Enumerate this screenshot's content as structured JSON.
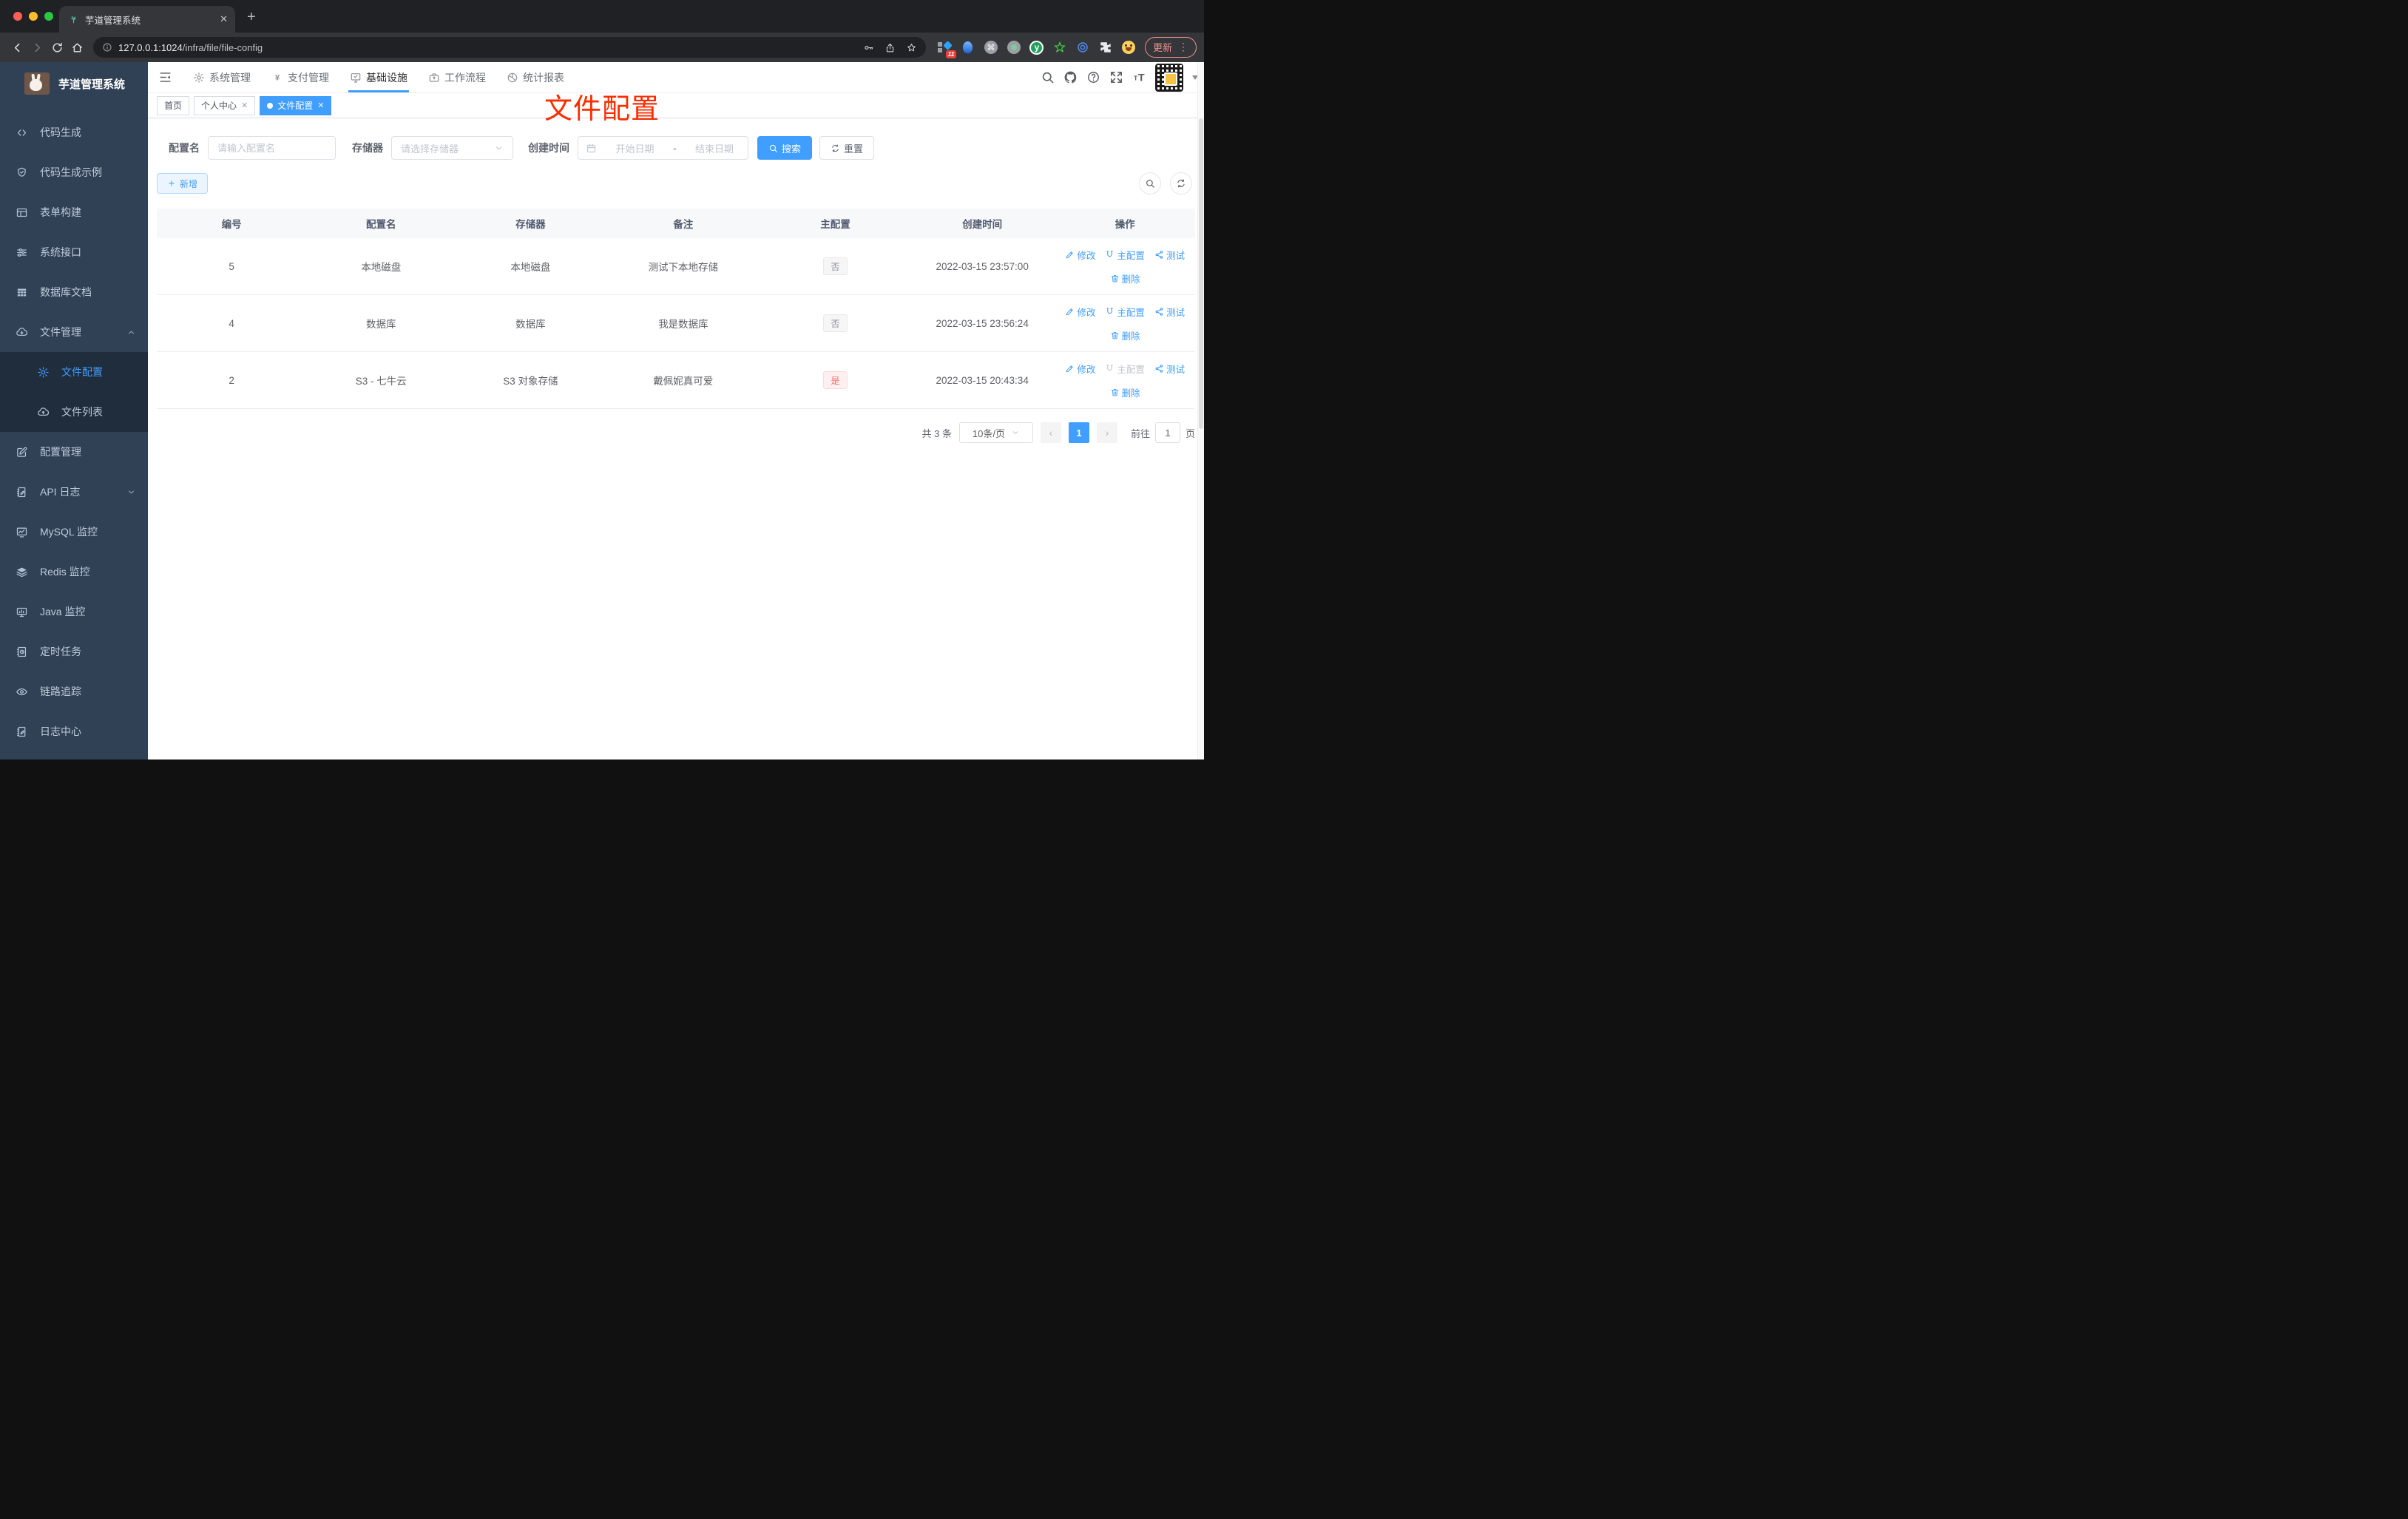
{
  "browser": {
    "tab_title": "芋道管理系统",
    "url_host": "127.0.0.1:1024",
    "url_path": "/infra/file/file-config",
    "update_label": "更新",
    "ext_badge": "11",
    "icons": [
      "back",
      "forward",
      "reload",
      "home",
      "info",
      "key",
      "share-up",
      "star",
      "puzzle",
      "menu-dots"
    ]
  },
  "colors": {
    "accent": "#409eff",
    "danger": "#f56c6c",
    "annotation_red": "#ff2d00",
    "sidebar_bg": "#304156",
    "submenu_bg": "#1f2d3d"
  },
  "sidebar": {
    "logo_title": "芋道管理系统",
    "items": [
      {
        "key": "code-generation",
        "label": "代码生成",
        "icon": "code"
      },
      {
        "key": "code-example",
        "label": "代码生成示例",
        "icon": "shield"
      },
      {
        "key": "form-builder",
        "label": "表单构建",
        "icon": "form"
      },
      {
        "key": "system-api",
        "label": "系统接口",
        "icon": "sliders"
      },
      {
        "key": "db-doc",
        "label": "数据库文档",
        "icon": "dbgrid"
      },
      {
        "key": "file-management",
        "label": "文件管理",
        "icon": "clouddown",
        "expanded": true,
        "children": [
          {
            "key": "file-config",
            "label": "文件配置",
            "icon": "gear",
            "active": true
          },
          {
            "key": "file-list",
            "label": "文件列表",
            "icon": "cloudup"
          }
        ]
      },
      {
        "key": "config-management",
        "label": "配置管理",
        "icon": "editsq"
      },
      {
        "key": "api-log",
        "label": "API 日志",
        "icon": "note",
        "collapsible": true
      },
      {
        "key": "mysql-monitor",
        "label": "MySQL 监控",
        "icon": "chart"
      },
      {
        "key": "redis-monitor",
        "label": "Redis 监控",
        "icon": "layers"
      },
      {
        "key": "java-monitor",
        "label": "Java 监控",
        "icon": "monitor"
      },
      {
        "key": "scheduled-task",
        "label": "定时任务",
        "icon": "schedule"
      },
      {
        "key": "trace",
        "label": "链路追踪",
        "icon": "eye"
      },
      {
        "key": "log-center",
        "label": "日志中心",
        "icon": "note"
      }
    ]
  },
  "topnav": {
    "active_index": 2,
    "items": [
      {
        "key": "system",
        "label": "系统管理",
        "icon": "gear"
      },
      {
        "key": "pay",
        "label": "支付管理",
        "icon": "yen"
      },
      {
        "key": "infra",
        "label": "基础设施",
        "icon": "infra"
      },
      {
        "key": "workflow",
        "label": "工作流程",
        "icon": "workflow"
      },
      {
        "key": "report",
        "label": "统计报表",
        "icon": "stats"
      }
    ],
    "right_icons": [
      "search",
      "github",
      "help",
      "fullscreen",
      "font-size",
      "avatar",
      "caret-down"
    ]
  },
  "tabs": [
    {
      "label": "首页",
      "closable": false,
      "active": false
    },
    {
      "label": "个人中心",
      "closable": true,
      "active": false
    },
    {
      "label": "文件配置",
      "closable": true,
      "active": true
    }
  ],
  "annotation": {
    "text": "文件配置"
  },
  "filters": {
    "config_name_label": "配置名",
    "config_name_placeholder": "请输入配置名",
    "storage_label": "存储器",
    "storage_placeholder": "请选择存储器",
    "created_label": "创建时间",
    "date_start_placeholder": "开始日期",
    "date_separator": "-",
    "date_end_placeholder": "结束日期",
    "search_label": "搜索",
    "reset_label": "重置"
  },
  "toolbar": {
    "add_label": "新增"
  },
  "table": {
    "columns": [
      "编号",
      "配置名",
      "存储器",
      "备注",
      "主配置",
      "创建时间",
      "操作"
    ],
    "action_labels": {
      "edit": "修改",
      "master": "主配置",
      "test": "测试",
      "delete": "删除"
    },
    "rows": [
      {
        "id": "5",
        "name": "本地磁盘",
        "storage": "本地磁盘",
        "remark": "测试下本地存储",
        "primary": "否",
        "primary_type": "info",
        "created": "2022-03-15 23:57:00",
        "master_disabled": false
      },
      {
        "id": "4",
        "name": "数据库",
        "storage": "数据库",
        "remark": "我是数据库",
        "primary": "否",
        "primary_type": "info",
        "created": "2022-03-15 23:56:24",
        "master_disabled": false
      },
      {
        "id": "2",
        "name": "S3 - 七牛云",
        "storage": "S3 对象存储",
        "remark": "戴佩妮真可爱",
        "primary": "是",
        "primary_type": "danger",
        "created": "2022-03-15 20:43:34",
        "master_disabled": true
      }
    ]
  },
  "pagination": {
    "total_text": "共 3 条",
    "page_size": "10条/页",
    "prev": "‹",
    "current_page": "1",
    "next": "›",
    "goto_label": "前往",
    "goto_value": "1",
    "page_suffix": "页"
  }
}
